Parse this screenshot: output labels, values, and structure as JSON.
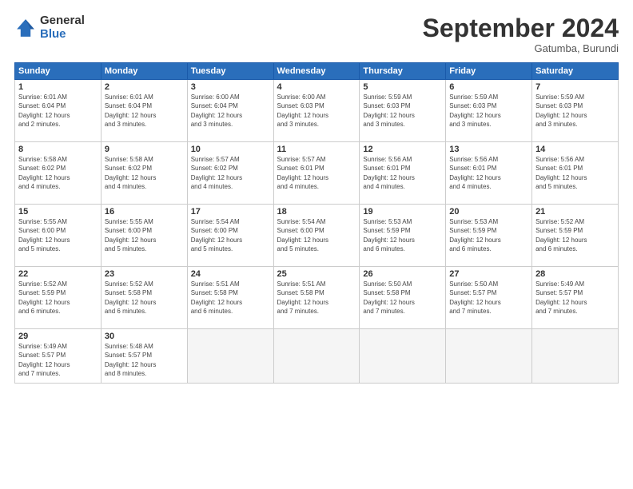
{
  "logo": {
    "general": "General",
    "blue": "Blue"
  },
  "header": {
    "month": "September 2024",
    "location": "Gatumba, Burundi"
  },
  "weekdays": [
    "Sunday",
    "Monday",
    "Tuesday",
    "Wednesday",
    "Thursday",
    "Friday",
    "Saturday"
  ],
  "weeks": [
    [
      {
        "day": "1",
        "info": "Sunrise: 6:01 AM\nSunset: 6:04 PM\nDaylight: 12 hours\nand 2 minutes."
      },
      {
        "day": "2",
        "info": "Sunrise: 6:01 AM\nSunset: 6:04 PM\nDaylight: 12 hours\nand 3 minutes."
      },
      {
        "day": "3",
        "info": "Sunrise: 6:00 AM\nSunset: 6:04 PM\nDaylight: 12 hours\nand 3 minutes."
      },
      {
        "day": "4",
        "info": "Sunrise: 6:00 AM\nSunset: 6:03 PM\nDaylight: 12 hours\nand 3 minutes."
      },
      {
        "day": "5",
        "info": "Sunrise: 5:59 AM\nSunset: 6:03 PM\nDaylight: 12 hours\nand 3 minutes."
      },
      {
        "day": "6",
        "info": "Sunrise: 5:59 AM\nSunset: 6:03 PM\nDaylight: 12 hours\nand 3 minutes."
      },
      {
        "day": "7",
        "info": "Sunrise: 5:59 AM\nSunset: 6:03 PM\nDaylight: 12 hours\nand 3 minutes."
      }
    ],
    [
      {
        "day": "8",
        "info": "Sunrise: 5:58 AM\nSunset: 6:02 PM\nDaylight: 12 hours\nand 4 minutes."
      },
      {
        "day": "9",
        "info": "Sunrise: 5:58 AM\nSunset: 6:02 PM\nDaylight: 12 hours\nand 4 minutes."
      },
      {
        "day": "10",
        "info": "Sunrise: 5:57 AM\nSunset: 6:02 PM\nDaylight: 12 hours\nand 4 minutes."
      },
      {
        "day": "11",
        "info": "Sunrise: 5:57 AM\nSunset: 6:01 PM\nDaylight: 12 hours\nand 4 minutes."
      },
      {
        "day": "12",
        "info": "Sunrise: 5:56 AM\nSunset: 6:01 PM\nDaylight: 12 hours\nand 4 minutes."
      },
      {
        "day": "13",
        "info": "Sunrise: 5:56 AM\nSunset: 6:01 PM\nDaylight: 12 hours\nand 4 minutes."
      },
      {
        "day": "14",
        "info": "Sunrise: 5:56 AM\nSunset: 6:01 PM\nDaylight: 12 hours\nand 5 minutes."
      }
    ],
    [
      {
        "day": "15",
        "info": "Sunrise: 5:55 AM\nSunset: 6:00 PM\nDaylight: 12 hours\nand 5 minutes."
      },
      {
        "day": "16",
        "info": "Sunrise: 5:55 AM\nSunset: 6:00 PM\nDaylight: 12 hours\nand 5 minutes."
      },
      {
        "day": "17",
        "info": "Sunrise: 5:54 AM\nSunset: 6:00 PM\nDaylight: 12 hours\nand 5 minutes."
      },
      {
        "day": "18",
        "info": "Sunrise: 5:54 AM\nSunset: 6:00 PM\nDaylight: 12 hours\nand 5 minutes."
      },
      {
        "day": "19",
        "info": "Sunrise: 5:53 AM\nSunset: 5:59 PM\nDaylight: 12 hours\nand 6 minutes."
      },
      {
        "day": "20",
        "info": "Sunrise: 5:53 AM\nSunset: 5:59 PM\nDaylight: 12 hours\nand 6 minutes."
      },
      {
        "day": "21",
        "info": "Sunrise: 5:52 AM\nSunset: 5:59 PM\nDaylight: 12 hours\nand 6 minutes."
      }
    ],
    [
      {
        "day": "22",
        "info": "Sunrise: 5:52 AM\nSunset: 5:59 PM\nDaylight: 12 hours\nand 6 minutes."
      },
      {
        "day": "23",
        "info": "Sunrise: 5:52 AM\nSunset: 5:58 PM\nDaylight: 12 hours\nand 6 minutes."
      },
      {
        "day": "24",
        "info": "Sunrise: 5:51 AM\nSunset: 5:58 PM\nDaylight: 12 hours\nand 6 minutes."
      },
      {
        "day": "25",
        "info": "Sunrise: 5:51 AM\nSunset: 5:58 PM\nDaylight: 12 hours\nand 7 minutes."
      },
      {
        "day": "26",
        "info": "Sunrise: 5:50 AM\nSunset: 5:58 PM\nDaylight: 12 hours\nand 7 minutes."
      },
      {
        "day": "27",
        "info": "Sunrise: 5:50 AM\nSunset: 5:57 PM\nDaylight: 12 hours\nand 7 minutes."
      },
      {
        "day": "28",
        "info": "Sunrise: 5:49 AM\nSunset: 5:57 PM\nDaylight: 12 hours\nand 7 minutes."
      }
    ],
    [
      {
        "day": "29",
        "info": "Sunrise: 5:49 AM\nSunset: 5:57 PM\nDaylight: 12 hours\nand 7 minutes."
      },
      {
        "day": "30",
        "info": "Sunrise: 5:48 AM\nSunset: 5:57 PM\nDaylight: 12 hours\nand 8 minutes."
      },
      {
        "day": "",
        "info": ""
      },
      {
        "day": "",
        "info": ""
      },
      {
        "day": "",
        "info": ""
      },
      {
        "day": "",
        "info": ""
      },
      {
        "day": "",
        "info": ""
      }
    ]
  ]
}
